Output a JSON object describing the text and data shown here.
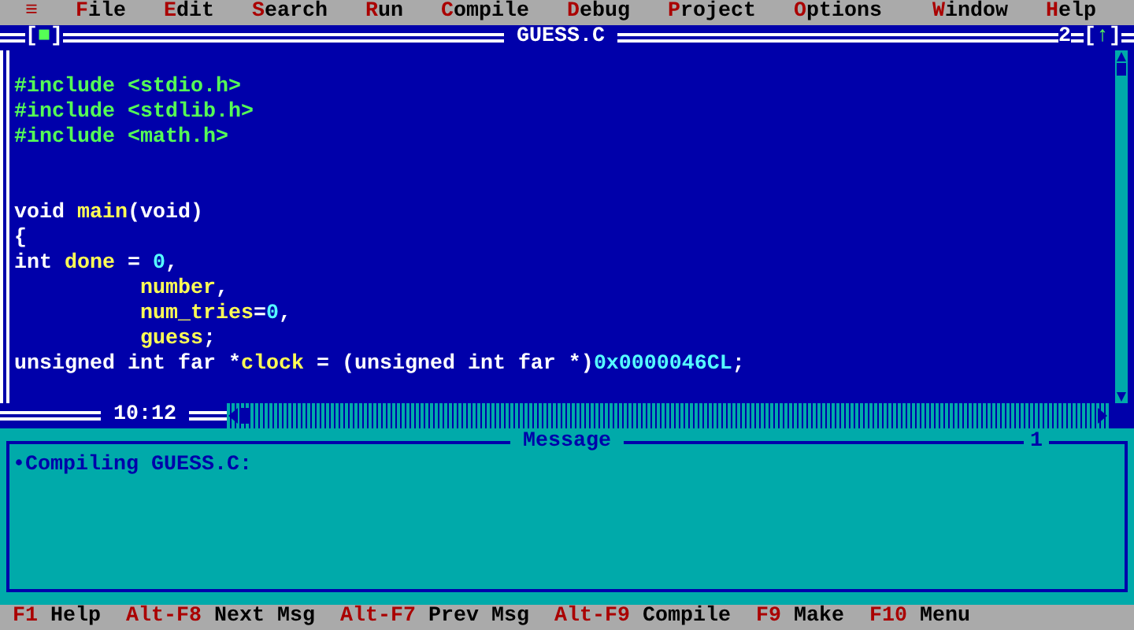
{
  "menu_bar": {
    "system_menu": "≡",
    "items": [
      {
        "hotkey": "F",
        "rest": "ile"
      },
      {
        "hotkey": "E",
        "rest": "dit"
      },
      {
        "hotkey": "S",
        "rest": "earch"
      },
      {
        "hotkey": "R",
        "rest": "un"
      },
      {
        "hotkey": "C",
        "rest": "ompile"
      },
      {
        "hotkey": "D",
        "rest": "ebug"
      },
      {
        "hotkey": "P",
        "rest": "roject"
      },
      {
        "hotkey": "O",
        "rest": "ptions"
      },
      {
        "hotkey": "W",
        "rest": "indow"
      },
      {
        "hotkey": "H",
        "rest": "elp"
      }
    ]
  },
  "editor": {
    "close_box": {
      "open": "[",
      "mark": "■",
      "close": "]"
    },
    "title": "GUESS.C",
    "window_number": "2",
    "zoom_box": {
      "open": "[",
      "mark": "↑",
      "close": "]"
    },
    "cursor_position": "10:12",
    "code_blocks": [
      [
        [
          {
            "kind": "directive",
            "text": "#include <stdio.h>"
          }
        ],
        [
          {
            "kind": "directive",
            "text": "#include <stdlib.h>"
          }
        ],
        [
          {
            "kind": "directive",
            "text": "#include <math.h>"
          }
        ]
      ],
      [
        [
          {
            "kind": "plain",
            "text": "void "
          },
          {
            "kind": "identifier",
            "text": "main"
          },
          {
            "kind": "plain",
            "text": "(void)"
          }
        ],
        [
          {
            "kind": "plain",
            "text": "{"
          }
        ],
        [
          {
            "kind": "plain",
            "text": "int "
          },
          {
            "kind": "identifier",
            "text": "done"
          },
          {
            "kind": "plain",
            "text": " = "
          },
          {
            "kind": "number",
            "text": "0"
          },
          {
            "kind": "plain",
            "text": ","
          }
        ],
        [
          {
            "kind": "indent"
          },
          {
            "kind": "identifier",
            "text": "number"
          },
          {
            "kind": "plain",
            "text": ","
          }
        ],
        [
          {
            "kind": "indent"
          },
          {
            "kind": "identifier",
            "text": "num_tries"
          },
          {
            "kind": "plain",
            "text": "="
          },
          {
            "kind": "number",
            "text": "0"
          },
          {
            "kind": "plain",
            "text": ","
          }
        ],
        [
          {
            "kind": "indent"
          },
          {
            "kind": "identifier",
            "text": "guess"
          },
          {
            "kind": "plain",
            "text": ";"
          }
        ],
        [
          {
            "kind": "plain",
            "text": "unsigned int far *"
          },
          {
            "kind": "identifier",
            "text": "clock"
          },
          {
            "kind": "plain",
            "text": " = (unsigned int far *)"
          },
          {
            "kind": "number",
            "text": "0x0000046CL"
          },
          {
            "kind": "plain",
            "text": ";"
          }
        ]
      ]
    ]
  },
  "message_window": {
    "title": "Message",
    "window_number": "1",
    "messages": [
      "•Compiling GUESS.C:"
    ]
  },
  "status_bar": [
    {
      "key": "F1",
      "label": "Help"
    },
    {
      "key": "Alt-F8",
      "label": "Next Msg"
    },
    {
      "key": "Alt-F7",
      "label": "Prev Msg"
    },
    {
      "key": "Alt-F9",
      "label": "Compile"
    },
    {
      "key": "F9",
      "label": "Make"
    },
    {
      "key": "F10",
      "label": "Menu"
    }
  ]
}
